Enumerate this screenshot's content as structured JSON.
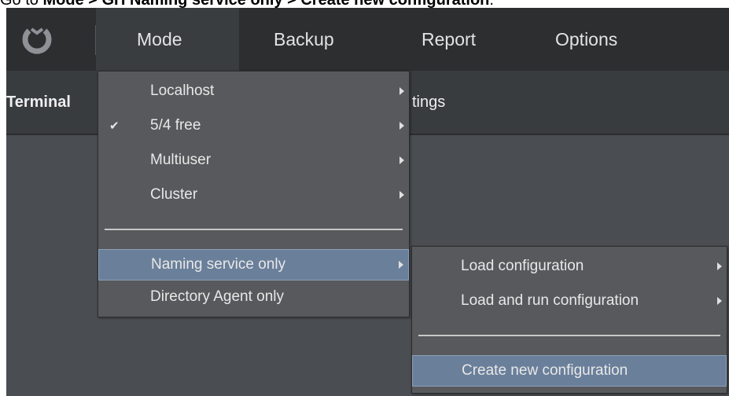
{
  "caption": {
    "prefix": "Go to ",
    "path": "Mode > GH Naming service only > Create new configuration",
    "suffix": "."
  },
  "menubar": {
    "items": [
      {
        "label": "Mode"
      },
      {
        "label": "Backup"
      },
      {
        "label": "Report"
      },
      {
        "label": "Options"
      }
    ]
  },
  "subbar": {
    "terminal_label": "Terminal",
    "settings_label": "tings"
  },
  "mode_menu": {
    "items": [
      {
        "label": "Localhost",
        "checked": false,
        "submenu": true
      },
      {
        "label": "5/4 free",
        "checked": true,
        "submenu": true
      },
      {
        "label": "Multiuser",
        "checked": false,
        "submenu": true
      },
      {
        "label": "Cluster",
        "checked": false,
        "submenu": true
      },
      {
        "label": "Naming service only",
        "checked": false,
        "submenu": true,
        "highlighted": true
      },
      {
        "label": "Directory Agent only",
        "checked": false,
        "submenu": false
      }
    ],
    "check_glyph": "✔"
  },
  "naming_submenu": {
    "items": [
      {
        "label": "Load configuration",
        "submenu": true
      },
      {
        "label": "Load and run configuration",
        "submenu": true
      },
      {
        "label": "Create new configuration",
        "submenu": false,
        "highlighted": true
      }
    ]
  },
  "colors": {
    "menubar_bg": "#2c2e30",
    "dropdown_bg": "#58595c",
    "highlight_bg": "#6a7f9a"
  }
}
